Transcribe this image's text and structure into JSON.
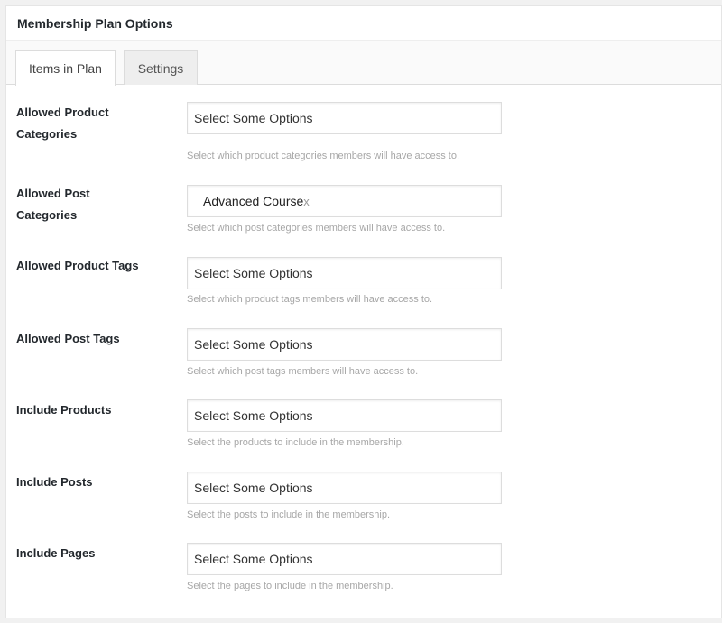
{
  "panel": {
    "title": "Membership Plan Options"
  },
  "tabs": {
    "items": "Items in Plan",
    "settings": "Settings"
  },
  "fields": [
    {
      "label_line1": "Allowed Product",
      "label_line2": "Categories",
      "placeholder": "Select Some Options",
      "description": "Select which product categories members will have access to."
    },
    {
      "label_line1": "Allowed Post Categories",
      "chip_text": "Advanced Course",
      "chip_remove": "x",
      "description": "Select which post categories members will have access to."
    },
    {
      "label_line1": "Allowed Product Tags",
      "placeholder": "Select Some Options",
      "description": "Select which product tags members will have access to."
    },
    {
      "label_line1": "Allowed Post Tags",
      "placeholder": "Select Some Options",
      "description": "Select which post tags members will have access to."
    },
    {
      "label_line1": "Include Products",
      "placeholder": "Select Some Options",
      "description": "Select the products to include in the membership."
    },
    {
      "label_line1": "Include Posts",
      "placeholder": "Select Some Options",
      "description": "Select the posts to include in the membership."
    },
    {
      "label_line1": "Include Pages",
      "placeholder": "Select Some Options",
      "description": "Select the pages to include in the membership."
    }
  ]
}
